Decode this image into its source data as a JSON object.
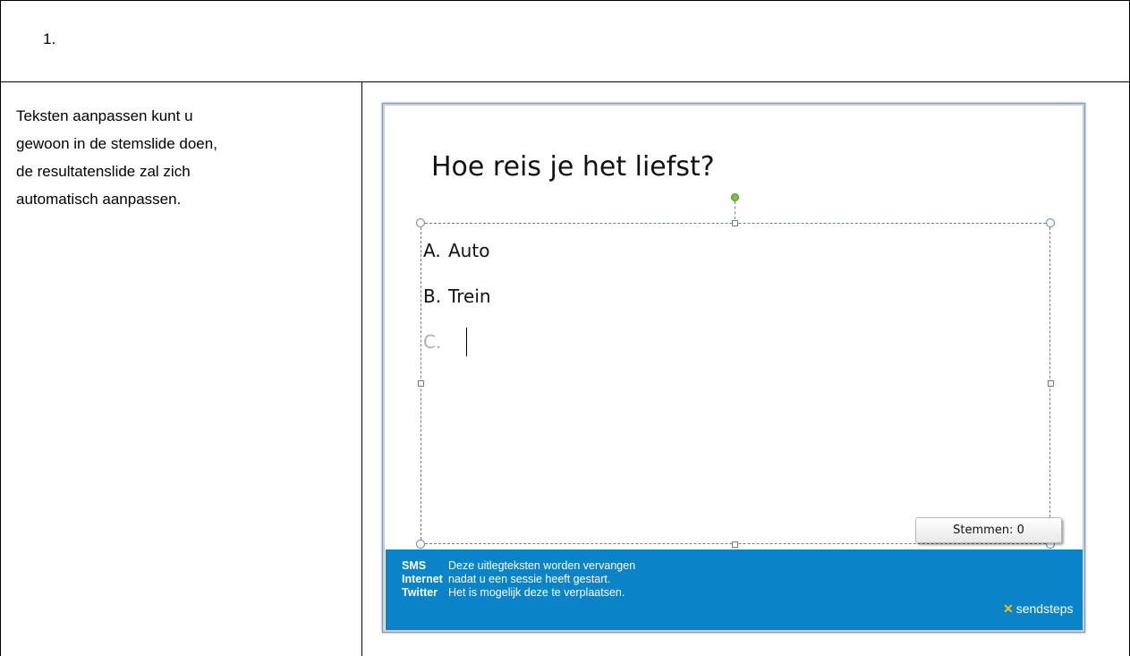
{
  "step": {
    "number": "1."
  },
  "instruction": {
    "lines": [
      "Teksten aanpassen kunt u",
      "gewoon in de stemslide doen,",
      "de resultatenslide zal zich",
      "automatisch aanpassen."
    ]
  },
  "slide": {
    "title": "Hoe reis je het liefst?",
    "options": [
      {
        "letter": "A.",
        "text": "Auto"
      },
      {
        "letter": "B.",
        "text": "Trein"
      },
      {
        "letter": "C.",
        "text": ""
      }
    ],
    "vote_button": "Stemmen: 0",
    "footer": {
      "rows": [
        {
          "channel": "SMS",
          "text": "Deze uitlegteksten worden vervangen"
        },
        {
          "channel": "Internet",
          "text": "nadat u een sessie heeft gestart."
        },
        {
          "channel": "Twitter",
          "text": "Het is mogelijk deze te verplaatsen."
        }
      ],
      "brand": "sendsteps",
      "brand_icon": "sendsteps-logo-icon",
      "color": "#0a83c8"
    }
  }
}
